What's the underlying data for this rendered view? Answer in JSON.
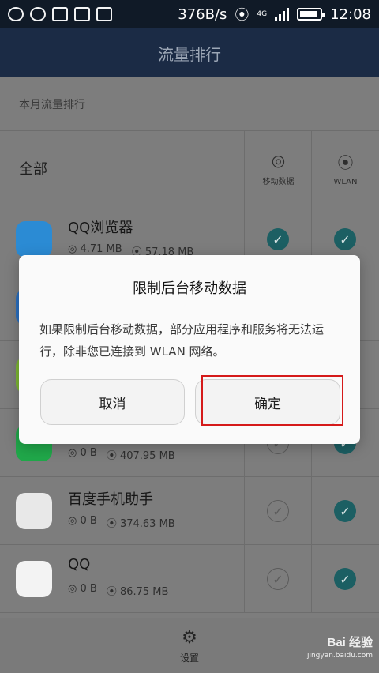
{
  "status_bar": {
    "speed": "376B/s",
    "network": "4G",
    "time": "12:08",
    "icons": [
      "wechat-icon",
      "wechat-icon",
      "alert-icon",
      "image-icon",
      "download-icon"
    ]
  },
  "title_bar": {
    "title": "流量排行"
  },
  "section": {
    "title": "本月流量排行"
  },
  "columns": {
    "all_label": "全部",
    "mobile_label": "移动数据",
    "wlan_label": "WLAN"
  },
  "apps": [
    {
      "name": "QQ浏览器",
      "mobile": "4.71 MB",
      "wifi": "57.18 MB",
      "mobile_on": true,
      "wlan_on": true,
      "color": "#2b8bd4"
    },
    {
      "name": "",
      "mobile": "",
      "wifi": "",
      "mobile_on": true,
      "wlan_on": true,
      "color": "#2a6fbf"
    },
    {
      "name": "",
      "mobile": "",
      "wifi": "",
      "mobile_on": true,
      "wlan_on": true,
      "color": "#7bb732"
    },
    {
      "name": "",
      "mobile": "0 B",
      "wifi": "407.95 MB",
      "mobile_on": false,
      "wlan_on": true,
      "color": "#20a84a"
    },
    {
      "name": "百度手机助手",
      "mobile": "0 B",
      "wifi": "374.63 MB",
      "mobile_on": false,
      "wlan_on": true,
      "color": "#e8e8e8"
    },
    {
      "name": "QQ",
      "mobile": "0 B",
      "wifi": "86.75 MB",
      "mobile_on": false,
      "wlan_on": true,
      "color": "#f3f3f3"
    }
  ],
  "bottom_nav": {
    "label": "设置"
  },
  "dialog": {
    "title": "限制后台移动数据",
    "message": "如果限制后台移动数据，部分应用程序和服务将无法运行，除非您已连接到 WLAN 网络。",
    "cancel_label": "取消",
    "ok_label": "确定"
  },
  "watermark": {
    "brand": "Bai 经验",
    "url": "jingyan.baidu.com"
  },
  "colors": {
    "accent": "#1c5f63",
    "titlebar": "#1b2b45",
    "highlight": "#d51a1a"
  }
}
